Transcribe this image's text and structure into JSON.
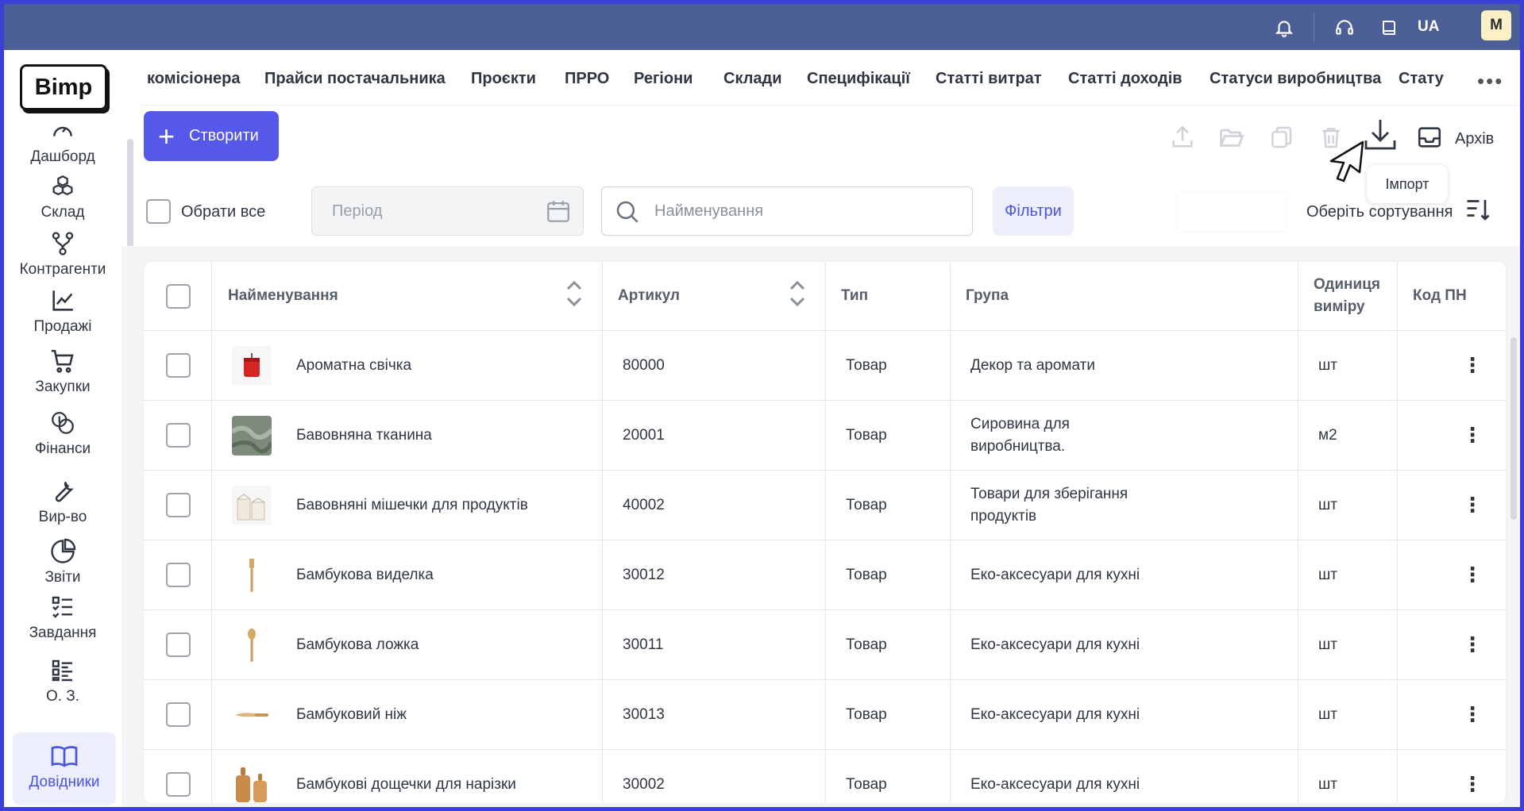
{
  "topbar": {
    "icons": [
      "bell-icon",
      "headset-icon",
      "book-icon"
    ],
    "lang": "UA",
    "avatar": "M"
  },
  "logo": "Bimp",
  "sidebar": {
    "items": [
      {
        "label": "Дашборд",
        "icon": "speedometer-icon"
      },
      {
        "label": "Склад",
        "icon": "boxes-icon"
      },
      {
        "label": "Контрагенти",
        "icon": "network-icon"
      },
      {
        "label": "Продажі",
        "icon": "chart-line-icon"
      },
      {
        "label": "Закупки",
        "icon": "cart-icon"
      },
      {
        "label": "Фінанси",
        "icon": "coins-icon"
      },
      {
        "label": "Вир-во",
        "icon": "wrench-icon"
      },
      {
        "label": "Звіти",
        "icon": "pie-chart-icon"
      },
      {
        "label": "Завдання",
        "icon": "checklist-icon"
      },
      {
        "label": "О. З.",
        "icon": "grid-list-icon"
      },
      {
        "label": "Довідники",
        "icon": "open-book-icon",
        "active": true
      }
    ]
  },
  "tabs": [
    "комісіонера",
    "Прайси постачальника",
    "Проєкти",
    "ПРРО",
    "Регіони",
    "Склади",
    "Специфікації",
    "Статті витрат",
    "Статті доходів",
    "Статуси виробництва",
    "Стату"
  ],
  "toolbar": {
    "create_label": "Створити",
    "archive_label": "Архів",
    "tooltip": "Імпорт"
  },
  "filters": {
    "select_all": "Обрати все",
    "period_placeholder": "Період",
    "search_placeholder": "Найменування",
    "filters_button": "Фільтри",
    "sort_label": "Оберіть сортування"
  },
  "table": {
    "headers": {
      "name": "Найменування",
      "sku": "Артикул",
      "type": "Тип",
      "group": "Група",
      "unit_line1": "Одиниця",
      "unit_line2": "виміру",
      "code": "Код ПН"
    },
    "rows": [
      {
        "name": "Ароматна свічка",
        "sku": "80000",
        "type": "Товар",
        "group1": "Декор та аромати",
        "group2": "",
        "unit": "шт",
        "thumb": "candle"
      },
      {
        "name": "Бавовняна тканина",
        "sku": "20001",
        "type": "Товар",
        "group1": "Сировина для",
        "group2": "виробництва.",
        "unit": "м2",
        "thumb": "fabric"
      },
      {
        "name": "Бавовняні мішечки для продуктів",
        "sku": "40002",
        "type": "Товар",
        "group1": "Товари для зберігання",
        "group2": "продуктів",
        "unit": "шт",
        "thumb": "bags"
      },
      {
        "name": "Бамбукова виделка",
        "sku": "30012",
        "type": "Товар",
        "group1": "Еко-аксесуари для кухні",
        "group2": "",
        "unit": "шт",
        "thumb": "fork"
      },
      {
        "name": "Бамбукова ложка",
        "sku": "30011",
        "type": "Товар",
        "group1": "Еко-аксесуари для кухні",
        "group2": "",
        "unit": "шт",
        "thumb": "spoon"
      },
      {
        "name": "Бамбуковий ніж",
        "sku": "30013",
        "type": "Товар",
        "group1": "Еко-аксесуари для кухні",
        "group2": "",
        "unit": "шт",
        "thumb": "knife"
      },
      {
        "name": "Бамбукові дощечки для нарізки",
        "sku": "30002",
        "type": "Товар",
        "group1": "Еко-аксесуари для кухні",
        "group2": "",
        "unit": "шт",
        "thumb": "boards"
      }
    ]
  },
  "colors": {
    "topbar": "#4b5e96",
    "accent": "#5558e8",
    "frame": "#3b3fd8"
  }
}
